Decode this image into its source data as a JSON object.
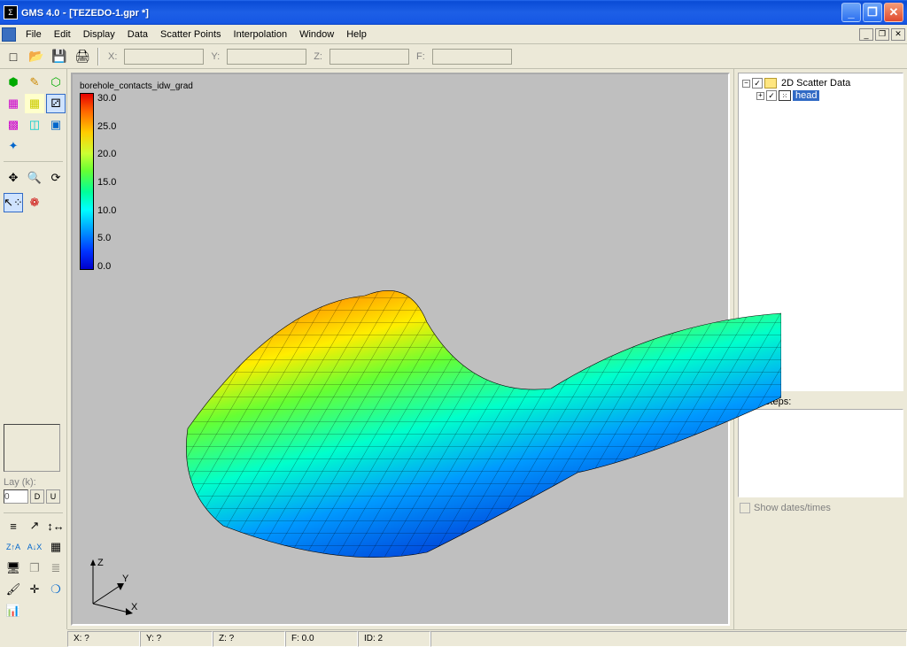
{
  "app": {
    "name": "GMS 4.0",
    "document": "[TEZEDO-1.gpr *]"
  },
  "menus": [
    "File",
    "Edit",
    "Display",
    "Data",
    "Scatter Points",
    "Interpolation",
    "Window",
    "Help"
  ],
  "top_coords": {
    "x_label": "X:",
    "y_label": "Y:",
    "z_label": "Z:",
    "f_label": "F:"
  },
  "toolbar": {
    "new": "□",
    "open": "📂",
    "save": "💾",
    "print": "🖨"
  },
  "left_tools": {
    "row1": [
      "hex-solid",
      "pencil",
      "hex-outline"
    ],
    "row2": [
      "grid-magenta",
      "grid-yellow",
      "dice"
    ],
    "row3": [
      "grid-cubes",
      "cyan-cube",
      "blue-cube"
    ],
    "row4": [
      "compass"
    ],
    "row5": [
      "pan",
      "zoom",
      "rotate"
    ],
    "row6": [
      "select-arrow",
      "select-spray"
    ],
    "lay_label": "Lay (k):",
    "lay_value": "0",
    "d_btn": "D",
    "u_btn": "U",
    "bottom_tools": [
      [
        "t-bars",
        "t-line",
        "t-axes"
      ],
      [
        "t-za",
        "t-ax",
        "t-grid"
      ],
      [
        "t-comp",
        "t-copy",
        "t-notes"
      ],
      [
        "t-brush",
        "t-center",
        "t-drop"
      ],
      [
        "t-chart",
        "",
        ""
      ]
    ]
  },
  "legend": {
    "title": "borehole_contacts_idw_grad",
    "ticks": [
      "30.0",
      "25.0",
      "20.0",
      "15.0",
      "10.0",
      "5.0",
      "0.0"
    ]
  },
  "axes_labels": {
    "x": "X",
    "y": "Y",
    "z": "Z"
  },
  "tree": {
    "root": {
      "label": "2D Scatter Data",
      "expanded": true,
      "checked": true
    },
    "child": {
      "label": "head",
      "checked": true,
      "selected": true
    }
  },
  "right_panel": {
    "time_steps_label": "Time Steps:",
    "show_dates_label": "Show dates/times"
  },
  "status": {
    "x": "X: ?",
    "y": "Y: ?",
    "z": "Z: ?",
    "f": "F: 0.0",
    "id": "ID:   2"
  }
}
